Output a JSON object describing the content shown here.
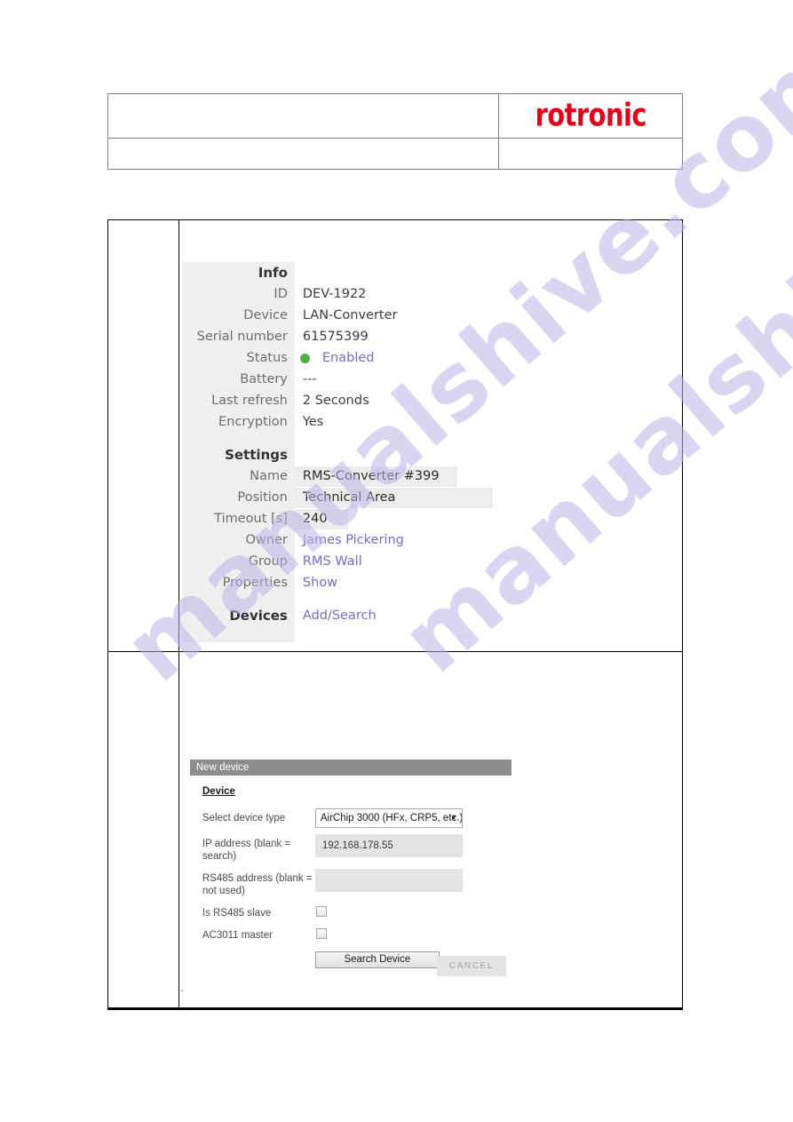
{
  "page": {
    "watermark_left": "manualshive.com",
    "watermark_right": "manualshive.com",
    "brand_logo": "rotronic",
    "brand_color": "#e2001a",
    "tiny_mark": "-"
  },
  "rms_panel": {
    "info_heading": "Info",
    "info_rows": [
      {
        "label": "ID",
        "value": "DEV-1922"
      },
      {
        "label": "Device",
        "value": "LAN-Converter"
      },
      {
        "label": "Serial number",
        "value": "61575399"
      },
      {
        "label": "Battery",
        "value": "---"
      },
      {
        "label": "Last refresh",
        "value": "2 Seconds"
      },
      {
        "label": "Encryption",
        "value": "Yes"
      }
    ],
    "status": {
      "label": "Status",
      "value": "Enabled",
      "indicator_color": "#4caf3f"
    },
    "settings_heading": "Settings",
    "settings": {
      "name_label": "Name",
      "name_value": "RMS-Converter #399",
      "position_label": "Position",
      "position_value": "Technical Area",
      "timeout_label": "Timeout [s]",
      "timeout_value": "240",
      "owner_label": "Owner",
      "owner_value": "James Pickering",
      "group_label": "Group",
      "group_value": "RMS Wall",
      "properties_label": "Properties",
      "properties_value": "Show"
    },
    "devices_heading": "Devices",
    "devices_action": "Add/Search",
    "link_color": "#7a6ac6"
  },
  "new_device_dialog": {
    "title": "New device",
    "section_label": "Device",
    "device_type_label": "Select device type",
    "device_type_value": "AirChip 3000 (HFx, CRP5, etc.)",
    "ip_label": "IP address (blank = search)",
    "ip_value": "192.168.178.55",
    "rs485_label": "RS485 address (blank = not used)",
    "rs485_value": "",
    "is_rs485_slave_label": "Is RS485 slave",
    "is_rs485_slave_checked": false,
    "ac3011_master_label": "AC3011 master",
    "ac3011_master_checked": false,
    "search_button": "Search Device",
    "cancel_button": "CANCEL"
  }
}
